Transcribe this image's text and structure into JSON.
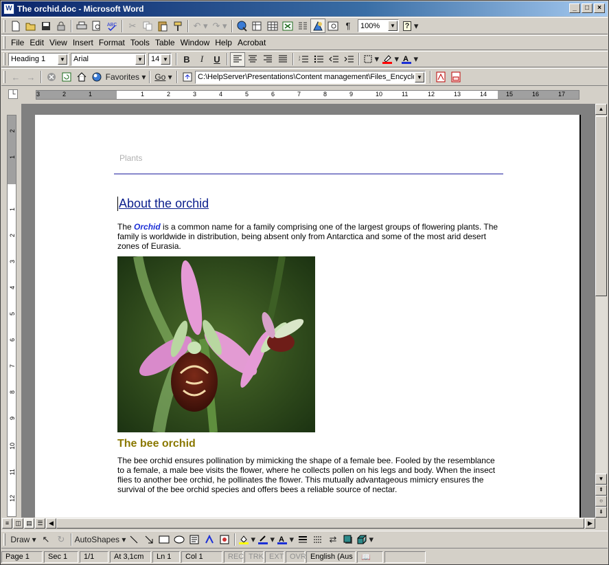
{
  "window": {
    "title": "The orchid.doc - Microsoft Word",
    "app_icon": "W",
    "minimize": "_",
    "restore": "□",
    "close": "×"
  },
  "standard_toolbar": {
    "icons": [
      "new-icon",
      "open-icon",
      "save-icon",
      "permission-icon",
      "print-icon",
      "print-preview-icon",
      "spelling-icon",
      "cut-icon",
      "copy-icon",
      "paste-icon",
      "format-painter-icon",
      "undo-icon",
      "redo-icon",
      "hyperlink-icon",
      "tables-borders-icon",
      "insert-table-icon",
      "insert-excel-icon",
      "columns-icon",
      "drawing-icon",
      "document-map-icon",
      "show-hide-icon"
    ],
    "zoom": "100%",
    "help": "?"
  },
  "menu": [
    "File",
    "Edit",
    "View",
    "Insert",
    "Format",
    "Tools",
    "Table",
    "Window",
    "Help",
    "Acrobat"
  ],
  "formatting_toolbar": {
    "style": "Heading 1",
    "font": "Arial",
    "size": "14",
    "bold": "B",
    "italic": "I",
    "underline": "U"
  },
  "web_toolbar": {
    "favorites": "Favorites",
    "go": "Go",
    "address": "C:\\HelpServer\\Presentations\\Content management\\Files_Encyclo"
  },
  "ruler": {
    "h_labels": [
      "3",
      "2",
      "1",
      "1",
      "2",
      "3",
      "4",
      "5",
      "6",
      "7",
      "8",
      "9",
      "10",
      "11",
      "12",
      "13",
      "14",
      "15",
      "16",
      "17"
    ],
    "v_labels": [
      "2",
      "1",
      "1",
      "2",
      "3",
      "4",
      "5",
      "6",
      "7",
      "8",
      "9",
      "10",
      "11",
      "12"
    ]
  },
  "document": {
    "header": "Plants",
    "heading": "About the orchid",
    "para1_pre": "The ",
    "para1_term": "Orchid",
    "para1_post": " is a common name for a family comprising one of the largest groups of flowering plants. The family is worldwide in distribution, being absent only from Antarctica and some of the most arid desert zones of Eurasia.",
    "subheading": "The bee orchid",
    "para2": "The bee orchid ensures pollination by mimicking the shape of a female bee. Fooled by the resemblance to a female, a male bee visits the flower, where he collects pollen on his legs and body. When the insect flies to another bee orchid, he pollinates the flower. This mutually advantageous mimicry ensures the survival of the bee orchid species and offers bees a reliable source of nectar."
  },
  "draw_toolbar": {
    "draw": "Draw",
    "autoshapes": "AutoShapes"
  },
  "status": {
    "page": "Page  1",
    "sec": "Sec  1",
    "pages": "1/1",
    "at": "At  3,1cm",
    "ln": "Ln  1",
    "col": "Col  1",
    "rec": "REC",
    "trk": "TRK",
    "ext": "EXT",
    "ovr": "OVR",
    "lang": "English (Aus"
  }
}
